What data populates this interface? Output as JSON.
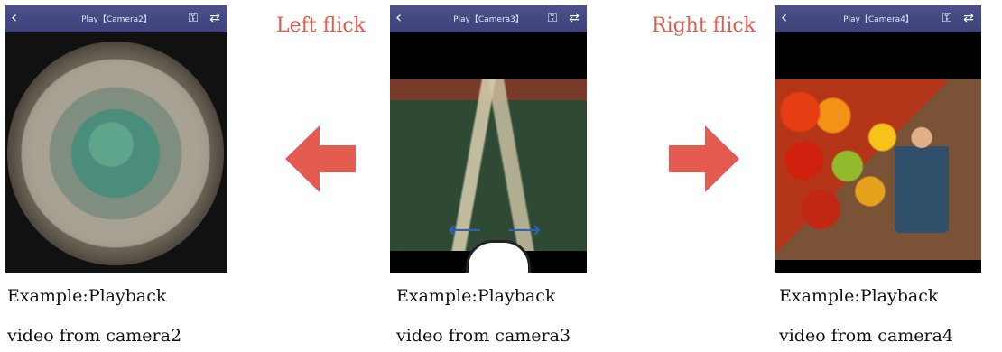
{
  "phones": [
    {
      "title": "Play【Camera2】",
      "back_icon": "chevron-left-icon",
      "icon1": "person-lock-icon",
      "icon2": "swap-arrows-icon"
    },
    {
      "title": "Play【Camera3】",
      "back_icon": "chevron-left-icon",
      "icon1": "person-lock-icon",
      "icon2": "swap-arrows-icon"
    },
    {
      "title": "Play【Camera4】",
      "back_icon": "chevron-left-icon",
      "icon1": "person-lock-icon",
      "icon2": "swap-arrows-icon"
    }
  ],
  "labels": {
    "left_flick": "Left flick",
    "right_flick": "Right flick"
  },
  "captions": {
    "camera2_line1": "Example:Playback",
    "camera2_line2": "video from camera2",
    "camera3_line1": "Example:Playback",
    "camera3_line2": "video from camera3",
    "camera4_line1": "Example:Playback",
    "camera4_line2": "video from camera4"
  },
  "colors": {
    "accent_red": "#e35c4f",
    "title_bar": "#3e4279",
    "gesture_blue": "#2c63b7"
  }
}
